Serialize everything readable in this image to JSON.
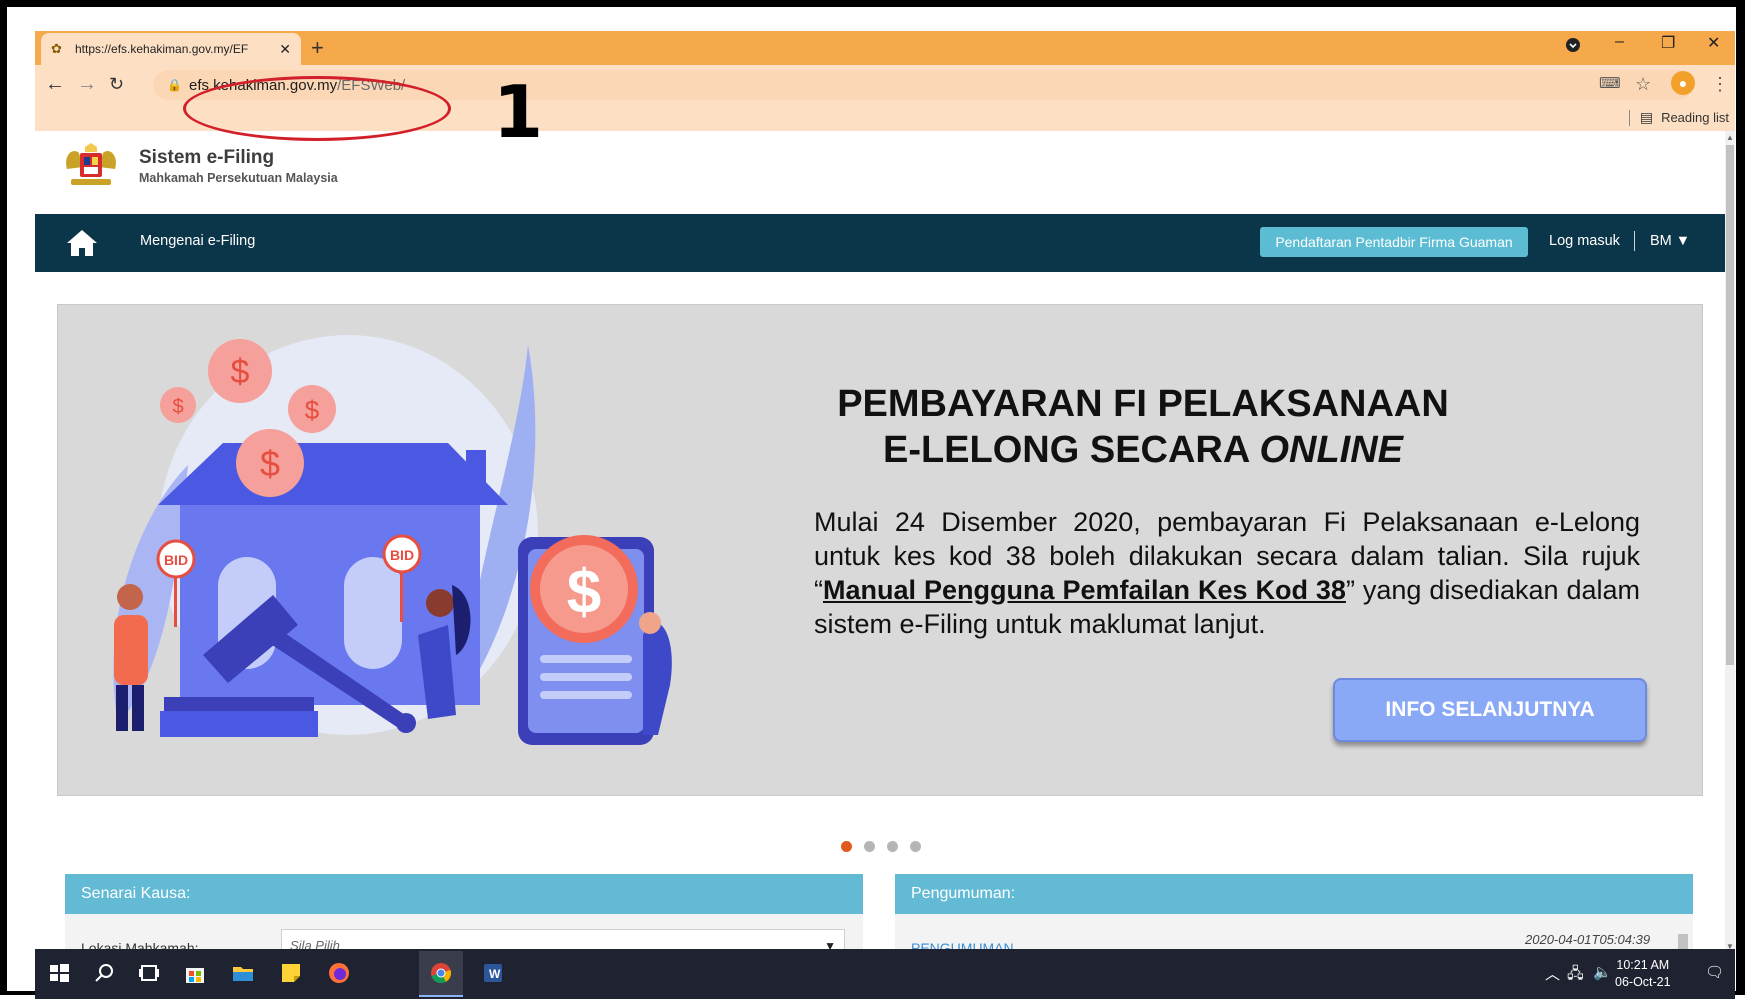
{
  "browser": {
    "tab_title": "https://efs.kehakiman.gov.my/EF",
    "new_tab": "+",
    "url_domain": "efs.kehakiman.gov.my",
    "url_path": "/EFSWeb/",
    "reading_list": "Reading list"
  },
  "annotation": {
    "number": "1",
    "color": "#d2202a"
  },
  "site": {
    "title": "Sistem e-Filing",
    "subtitle": "Mahkamah Persekutuan Malaysia"
  },
  "nav": {
    "about": "Mengenai e-Filing",
    "register": "Pendaftaran Pentadbir Firma Guaman",
    "login": "Log masuk",
    "lang": "BM ▼",
    "bg_color": "#0b3548"
  },
  "banner": {
    "heading_line1": "PEMBAYARAN FI PELAKSANAAN",
    "heading_line2_prefix": "E-LELONG SECARA ",
    "heading_line2_em": "ONLINE",
    "text_part1": "Mulai 24 Disember 2020, pembayaran Fi Pelaksanaan e-Lelong untuk kes kod 38 boleh dilakukan secara dalam talian. Sila rujuk “",
    "text_link": "Manual Pengguna Pemfailan Kes Kod 38",
    "text_part2": "” yang disediakan dalam sistem e-Filing untuk maklumat lanjut.",
    "button": "INFO SELANJUTNYA",
    "bid1": "BID",
    "bid2": "BID",
    "slides": 4,
    "active_slide": 1
  },
  "kausa": {
    "header": "Senarai Kausa:",
    "label": "Lokasi Mahkamah:",
    "select_value": "Sila Pilih"
  },
  "pengumuman": {
    "header": "Pengumuman:",
    "link": "PENGUMUMAN",
    "date": "2020-04-01T05:04:39"
  },
  "taskbar": {
    "time": "10:21 AM",
    "date": "06-Oct-21"
  }
}
